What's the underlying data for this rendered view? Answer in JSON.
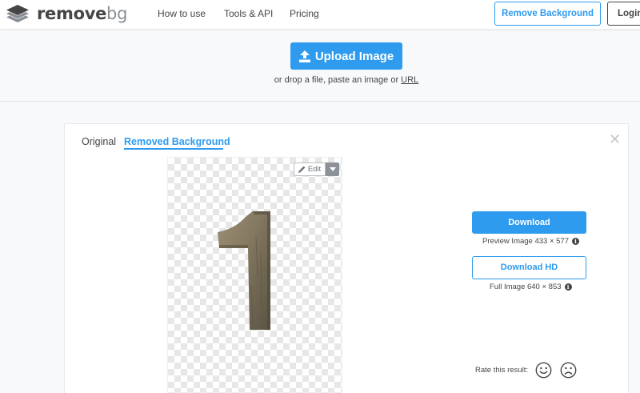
{
  "header": {
    "logo": {
      "text_main": "remove",
      "text_accent": "bg"
    },
    "nav": [
      {
        "label": "How to use"
      },
      {
        "label": "Tools & API"
      },
      {
        "label": "Pricing"
      }
    ],
    "remove_background_label": "Remove Background",
    "login_label": "Login"
  },
  "upload": {
    "button_label": "Upload Image",
    "drop_text_prefix": "or drop a file, paste an image or",
    "url_link": "URL"
  },
  "result": {
    "tabs": [
      {
        "label": "Original",
        "active": false
      },
      {
        "label": "Removed Background",
        "active": true
      }
    ],
    "edit_label": "Edit",
    "download_label": "Download",
    "preview_info": "Preview Image 433 × 577",
    "download_hd_label": "Download HD",
    "full_info": "Full Image 640 × 853",
    "rate_label": "Rate this result:"
  },
  "icons": {
    "logo": "layers-icon",
    "upload": "upload-icon",
    "edit": "pencil-icon",
    "caret": "caret-down-icon",
    "close": "close-icon",
    "info": "info-icon",
    "happy": "smiley-happy-icon",
    "sad": "smiley-sad-icon"
  },
  "colors": {
    "accent": "#2e9bef",
    "text": "#454545",
    "background": "#f8f9fb"
  }
}
